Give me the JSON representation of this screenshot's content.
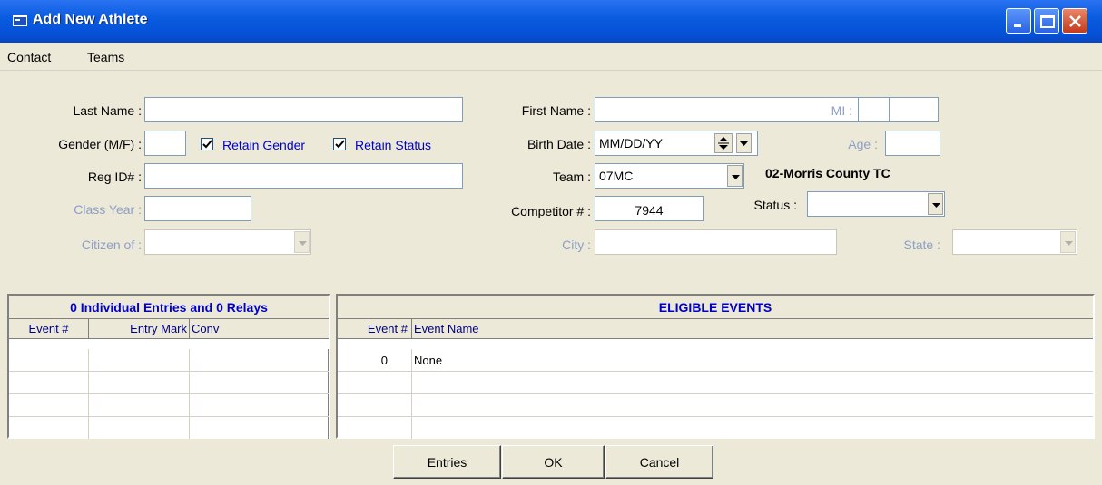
{
  "window": {
    "title": "Add New Athlete"
  },
  "menu": {
    "items": [
      "Contact",
      "Teams"
    ]
  },
  "form": {
    "last_name_label": "Last Name :",
    "last_name_value": "",
    "first_name_label": "First Name :",
    "first_name_value": "",
    "mi_label": "MI :",
    "mi_value": "",
    "gender_label": "Gender (M/F) :",
    "gender_value": "",
    "retain_gender_label": "Retain Gender",
    "retain_gender_checked": true,
    "retain_status_label": "Retain Status",
    "retain_status_checked": true,
    "birth_date_label": "Birth Date :",
    "birth_date_value": "MM/DD/YY",
    "age_label": "Age :",
    "age_value": "",
    "reg_id_label": "Reg ID# :",
    "reg_id_value": "",
    "team_label": "Team :",
    "team_value": "07MC",
    "team_name": "02-Morris County TC",
    "class_year_label": "Class Year :",
    "class_year_value": "",
    "competitor_label": "Competitor # :",
    "competitor_value": "7944",
    "status_label": "Status :",
    "status_value": "",
    "citizen_label": "Citizen of :",
    "citizen_value": "",
    "city_label": "City :",
    "city_value": "",
    "state_label": "State :",
    "state_value": ""
  },
  "entries_grid": {
    "title": "0 Individual Entries and 0 Relays",
    "columns": [
      "Event #",
      "Entry Mark",
      "Conv"
    ],
    "rows": [
      [
        "",
        "",
        ""
      ],
      [
        "",
        "",
        ""
      ],
      [
        "",
        "",
        ""
      ],
      [
        "",
        "",
        ""
      ]
    ]
  },
  "events_grid": {
    "title": "ELIGIBLE EVENTS",
    "columns": [
      "Event #",
      "Event Name"
    ],
    "rows": [
      [
        "0",
        "None"
      ],
      [
        "",
        ""
      ],
      [
        "",
        ""
      ],
      [
        "",
        ""
      ]
    ]
  },
  "buttons": {
    "entries": "Entries",
    "ok": "OK",
    "cancel": "Cancel"
  },
  "colors": {
    "titlebar": "#0551d6",
    "link_blue": "#0000cc",
    "disabled_label": "#8c9fc6"
  }
}
